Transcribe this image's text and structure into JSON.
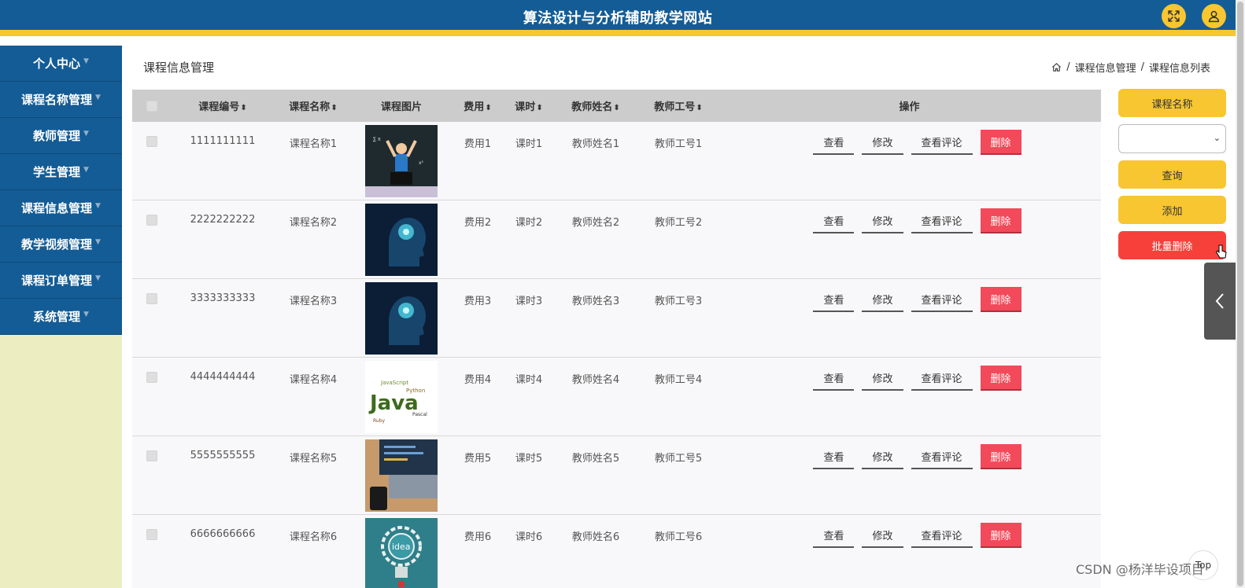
{
  "header": {
    "title": "算法设计与分析辅助教学网站"
  },
  "sidebar": {
    "items": [
      {
        "label": "个人中心"
      },
      {
        "label": "课程名称管理"
      },
      {
        "label": "教师管理"
      },
      {
        "label": "学生管理"
      },
      {
        "label": "课程信息管理"
      },
      {
        "label": "教学视频管理"
      },
      {
        "label": "课程订单管理"
      },
      {
        "label": "系统管理"
      }
    ]
  },
  "page": {
    "title": "课程信息管理",
    "breadcrumb": [
      "课程信息管理",
      "/",
      "课程信息列表"
    ],
    "breadcrumb_sep": "/"
  },
  "table": {
    "headers": {
      "no": "课程编号",
      "name": "课程名称",
      "img": "课程图片",
      "fee": "费用",
      "hours": "课时",
      "tname": "教师姓名",
      "tno": "教师工号",
      "ops": "操作"
    },
    "sort_glyph": "⬍",
    "rows": [
      {
        "no": "1111111111",
        "name": "课程名称1",
        "fee": "费用1",
        "hours": "课时1",
        "tname": "教师姓名1",
        "tno": "教师工号1",
        "img": "student-laptop"
      },
      {
        "no": "2222222222",
        "name": "课程名称2",
        "fee": "费用2",
        "hours": "课时2",
        "tname": "教师姓名2",
        "tno": "教师工号2",
        "img": "ai-head"
      },
      {
        "no": "3333333333",
        "name": "课程名称3",
        "fee": "费用3",
        "hours": "课时3",
        "tname": "教师姓名3",
        "tno": "教师工号3",
        "img": "ai-head"
      },
      {
        "no": "4444444444",
        "name": "课程名称4",
        "fee": "费用4",
        "hours": "课时4",
        "tname": "教师姓名4",
        "tno": "教师工号4",
        "img": "java-wordcloud"
      },
      {
        "no": "5555555555",
        "name": "课程名称5",
        "fee": "费用5",
        "hours": "课时5",
        "tname": "教师姓名5",
        "tno": "教师工号5",
        "img": "laptop-code"
      },
      {
        "no": "6666666666",
        "name": "课程名称6",
        "fee": "费用6",
        "hours": "课时6",
        "tname": "教师姓名6",
        "tno": "教师工号6",
        "img": "idea-bulb"
      }
    ],
    "ops": {
      "view": "查看",
      "edit": "修改",
      "comments": "查看评论",
      "delete": "删除"
    }
  },
  "rpanel": {
    "label": "课程名称",
    "select_value": "",
    "query": "查询",
    "add": "添加",
    "batch_delete": "批量删除"
  },
  "misc": {
    "top": "Top",
    "watermark": "CSDN @杨洋毕设项目"
  },
  "colors": {
    "header": "#145c95",
    "accent": "#f7c630",
    "danger": "#f24a5a",
    "sidebar_bg": "#eceec2"
  }
}
